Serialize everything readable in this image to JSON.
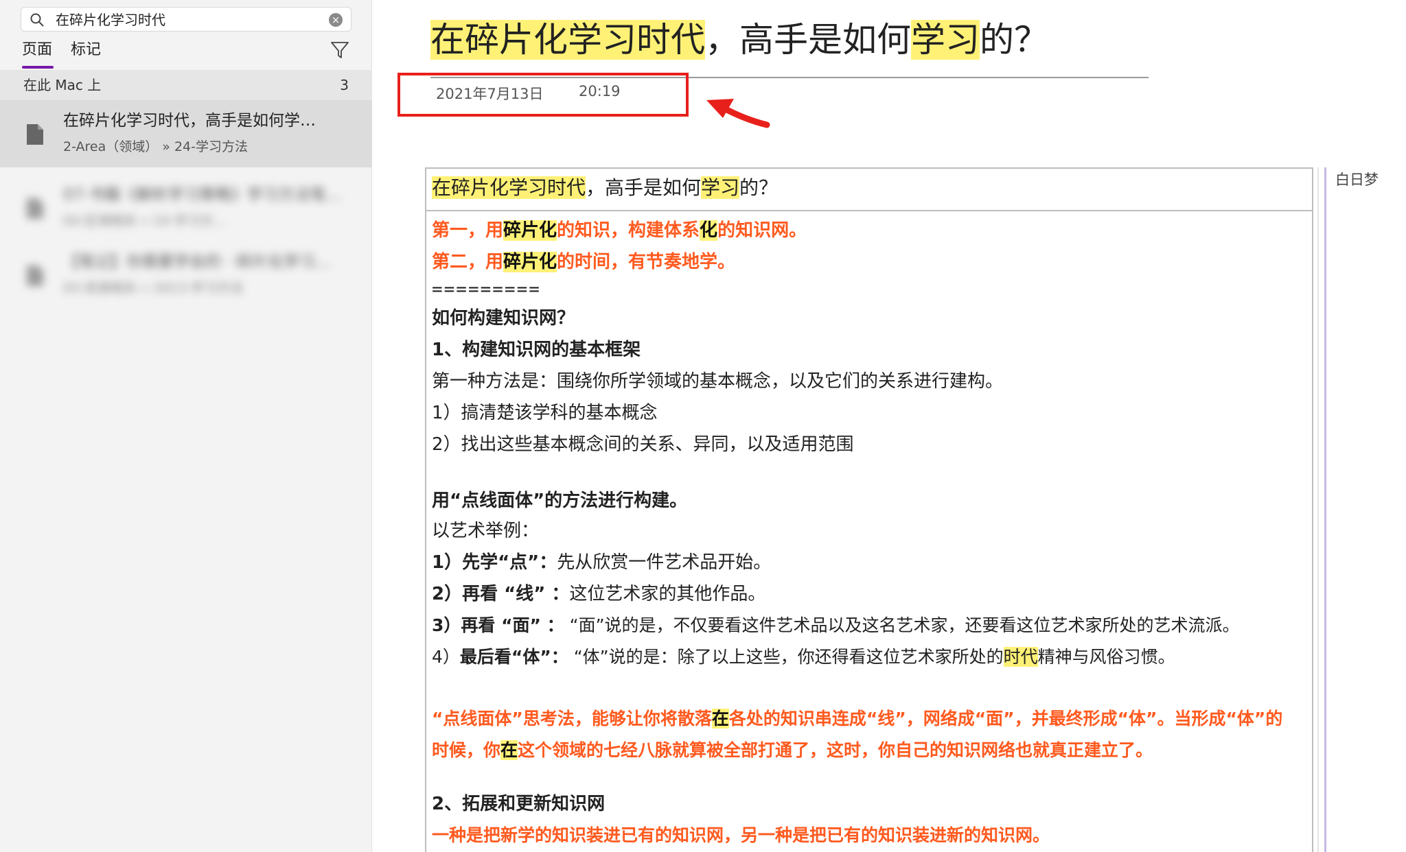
{
  "search": {
    "value": "在碎片化学习时代"
  },
  "tabs": {
    "pages": "页面",
    "tags": "标记"
  },
  "section": {
    "label": "在此 Mac 上",
    "count": "3"
  },
  "results": [
    {
      "title": "在碎片化学习时代，高手是如何学…",
      "path": "2-Area（领域） » 24-学习方法"
    },
    {
      "title": "07-书籍《解析学习策略》学习方法笔…",
      "path": "04-区域相关 » 24-学习方…"
    },
    {
      "title": "【笔记】你需要学会的 · 碎片化学习…",
      "path": "03-资源相关 » 2013-学习方法"
    }
  ],
  "page": {
    "title_hl1": "在碎片化学习时代",
    "title_mid": "，高手是如何",
    "title_hl2": "学习",
    "title_end": "的？",
    "date": "2021年7月13日",
    "time": "20:19"
  },
  "note": {
    "title_hl1": "在碎片化学习时代",
    "title_mid": "，高手是如何",
    "title_hl2": "学习",
    "title_end": "的？",
    "l1a": "第一，用",
    "l1b": "碎片化",
    "l1c": "的知识，构建体系",
    "l1d": "化",
    "l1e": "的知识网。",
    "l2a": "第二，用",
    "l2b": "碎片化",
    "l2c": "的时间，有节奏地学。",
    "l3": "=========",
    "l4": "如何构建知识网？",
    "l5": "1、构建知识网的基本框架",
    "l6": "第一种方法是：围绕你所学领域的基本概念，以及它们的关系进行建构。",
    "l7": "1）搞清楚该学科的基本概念",
    "l8": "2）找出这些基本概念间的关系、异同，以及适用范围",
    "l9": "用“点线面体”的方法进行构建。",
    "l10": "以艺术举例：",
    "l11a": "1）先学“点”：",
    "l11b": "先从欣赏一件艺术品开始。",
    "l12a": "2）再看 “线” ：",
    "l12b": "这位艺术家的其他作品。",
    "l13a": "3）再看 “面” ：",
    "l13b": " “面”说的是，不仅要看这件艺术品以及这名艺术家，还要看这位艺术家所处的艺术流派。",
    "l14a": "4）",
    "l14b": "最后看“体”：",
    "l14c": " “体”说的是：除了以上这些，你还得看这位艺术家所处的",
    "l14d": "时代",
    "l14e": "精神与风俗习惯。",
    "l15a": "“点线面体”思考法，能够让你将散落",
    "l15b": "在",
    "l15c": "各处的知识串连成“线”，网络成“面”，并最终形成“体”。当形成“体”的",
    "l16a": "时候，你",
    "l16b": "在",
    "l16c": "这个领域的七经八脉就算被全部打通了，这时，你自己的知识网络也就真正建立了。",
    "l17": "2、拓展和更新知识网",
    "l18": "一种是把新学的知识装进已有的知识网，另一种是把已有的知识装进新的知识网。"
  },
  "side_tag": "白日梦",
  "colors": {
    "highlight": "#fff176",
    "red_text": "#ff5a1f",
    "annotation": "#e8201b",
    "accent": "#7719aa"
  }
}
